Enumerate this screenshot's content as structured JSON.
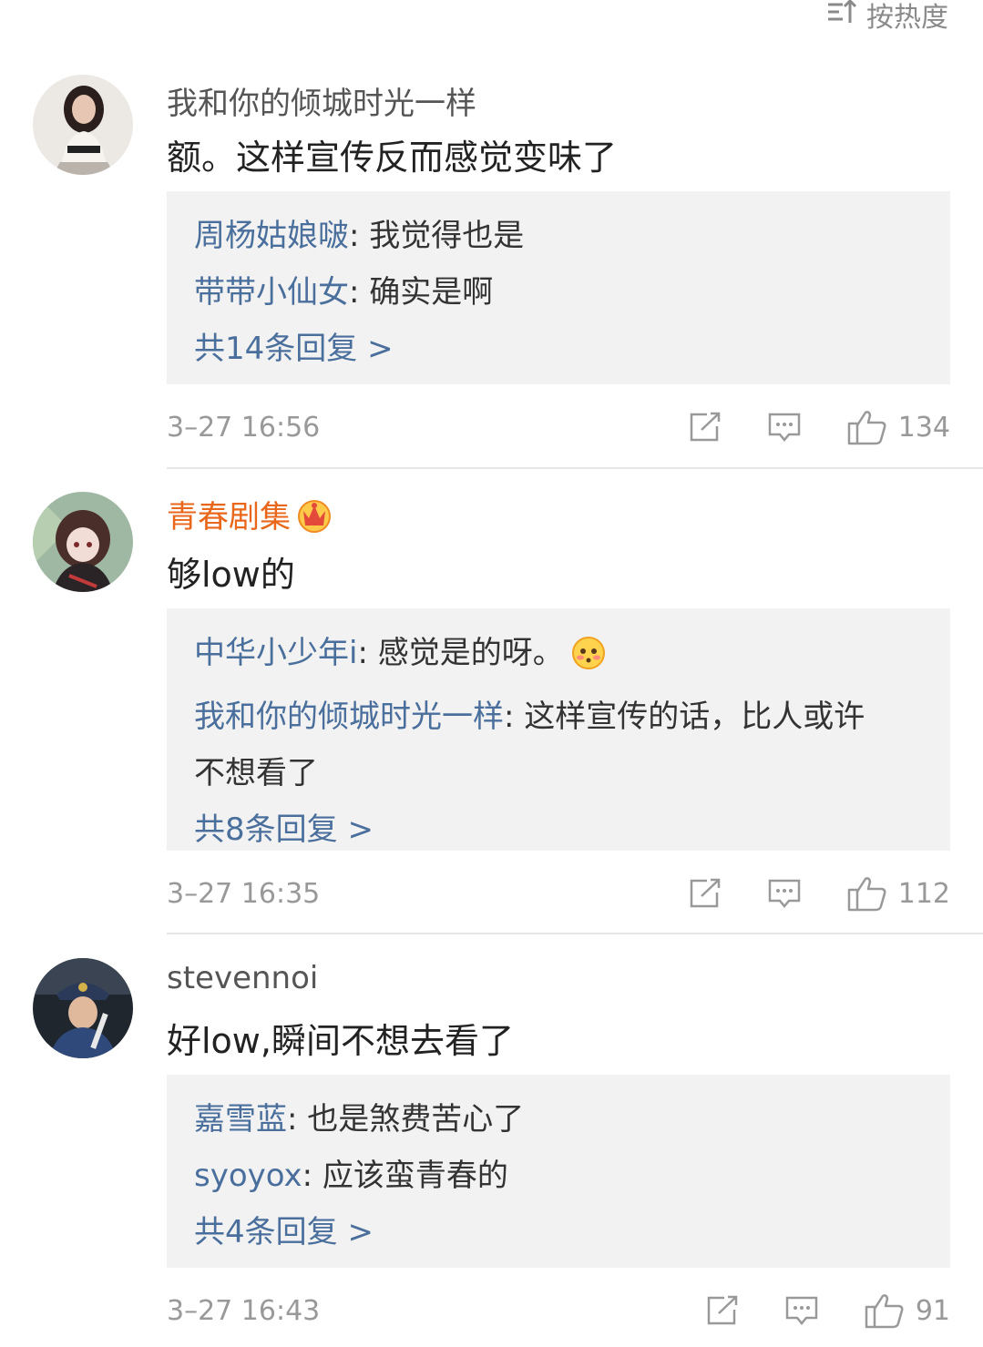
{
  "sort": {
    "label": "按热度"
  },
  "comments": [
    {
      "username": "我和你的倾城时光一样",
      "text": "额。这样宣传反而感觉变味了",
      "replies": [
        {
          "name": "周杨姑娘啵",
          "text": ": 我觉得也是"
        },
        {
          "name": "带带小仙女",
          "text": ": 确实是啊"
        }
      ],
      "more": "共14条回复 >",
      "time": "3–27 16:56",
      "likes": "134"
    },
    {
      "username": "青春剧集",
      "text": "够low的",
      "replies": [
        {
          "name": "中华小少年i",
          "text": ": 感觉是的呀。"
        },
        {
          "name": "我和你的倾城时光一样",
          "text": ": 这样宣传的话，比人或许",
          "text2": "不想看了"
        }
      ],
      "more": "共8条回复 >",
      "time": "3–27 16:35",
      "likes": "112"
    },
    {
      "username": "stevennoi",
      "text": "好low,瞬间不想去看了",
      "replies": [
        {
          "name": "嘉雪蓝",
          "text": ": 也是煞费苦心了"
        },
        {
          "name": "syoyox",
          "text": ": 应该蛮青春的"
        }
      ],
      "more": "共4条回复 >",
      "time": "3–27 16:43",
      "likes": "91"
    }
  ],
  "colors": {
    "link": "#4a6f9c",
    "vip": "#e8671b",
    "meta": "#999999",
    "reply_bg": "#f2f2f2"
  }
}
